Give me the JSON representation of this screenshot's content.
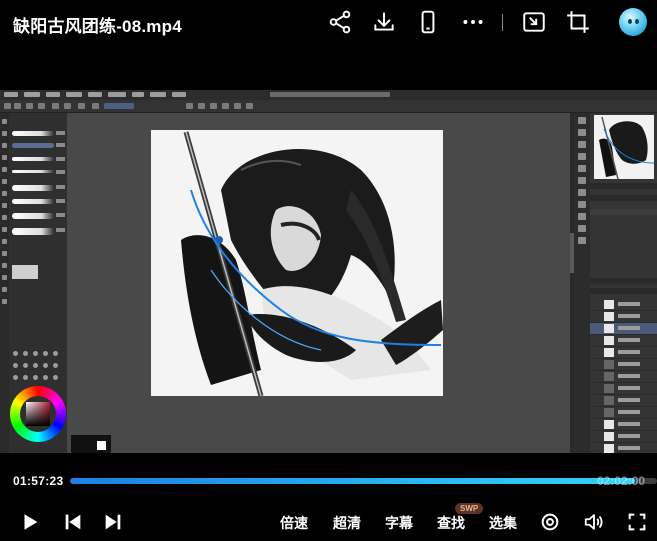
{
  "header": {
    "title": "缺阳古风团练-08.mp4",
    "icons": [
      "share-icon",
      "download-icon",
      "phone-icon",
      "more-icon",
      "picture-in-picture-icon",
      "crop-icon",
      "avatar"
    ]
  },
  "player": {
    "current_time": "01:57:23",
    "total_time": "02:02:00",
    "progress_fraction": 0.962,
    "accent_color": "#2ab5f0",
    "controls": {
      "speed": "倍速",
      "quality": "超清",
      "subtitles": "字幕",
      "search": "查找",
      "search_badge": "SWP",
      "episodes": "选集"
    }
  }
}
